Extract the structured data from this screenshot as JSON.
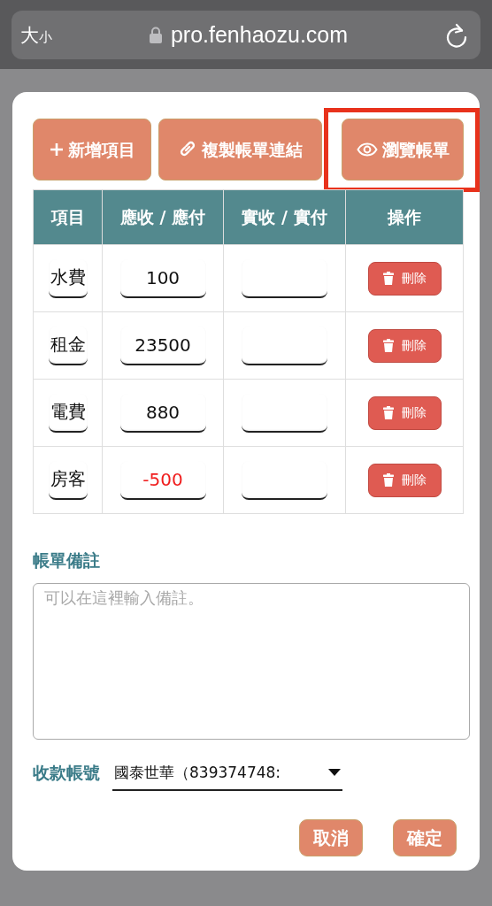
{
  "browser": {
    "text_size": "大",
    "text_size_small": "小",
    "address": "pro.fenhaozu.com"
  },
  "actions": [
    {
      "kind": "add",
      "label": "新增項目",
      "highlighted": false
    },
    {
      "kind": "link",
      "label": "複製帳單連結",
      "highlighted": false
    },
    {
      "kind": "view",
      "label": "瀏覽帳單",
      "highlighted": true
    }
  ],
  "table": {
    "columns": [
      "項目",
      "應收 / 應付",
      "實收 / 實付",
      "操作"
    ],
    "rows": [
      {
        "item": "水費",
        "due": "100",
        "due_negative": false,
        "paid": "",
        "action": "刪除"
      },
      {
        "item": "租金",
        "due": "23500",
        "due_negative": false,
        "paid": "",
        "action": "刪除"
      },
      {
        "item": "電費",
        "due": "880",
        "due_negative": false,
        "paid": "",
        "action": "刪除"
      },
      {
        "item": "房客",
        "due": "-500",
        "due_negative": true,
        "paid": "",
        "action": "刪除"
      }
    ]
  },
  "note": {
    "label": "帳單備註",
    "placeholder": "可以在這裡輸入備註。"
  },
  "account": {
    "label": "收款帳號",
    "value": "國泰世華（839374748:"
  },
  "buttons": [
    "取消",
    "確定"
  ]
}
